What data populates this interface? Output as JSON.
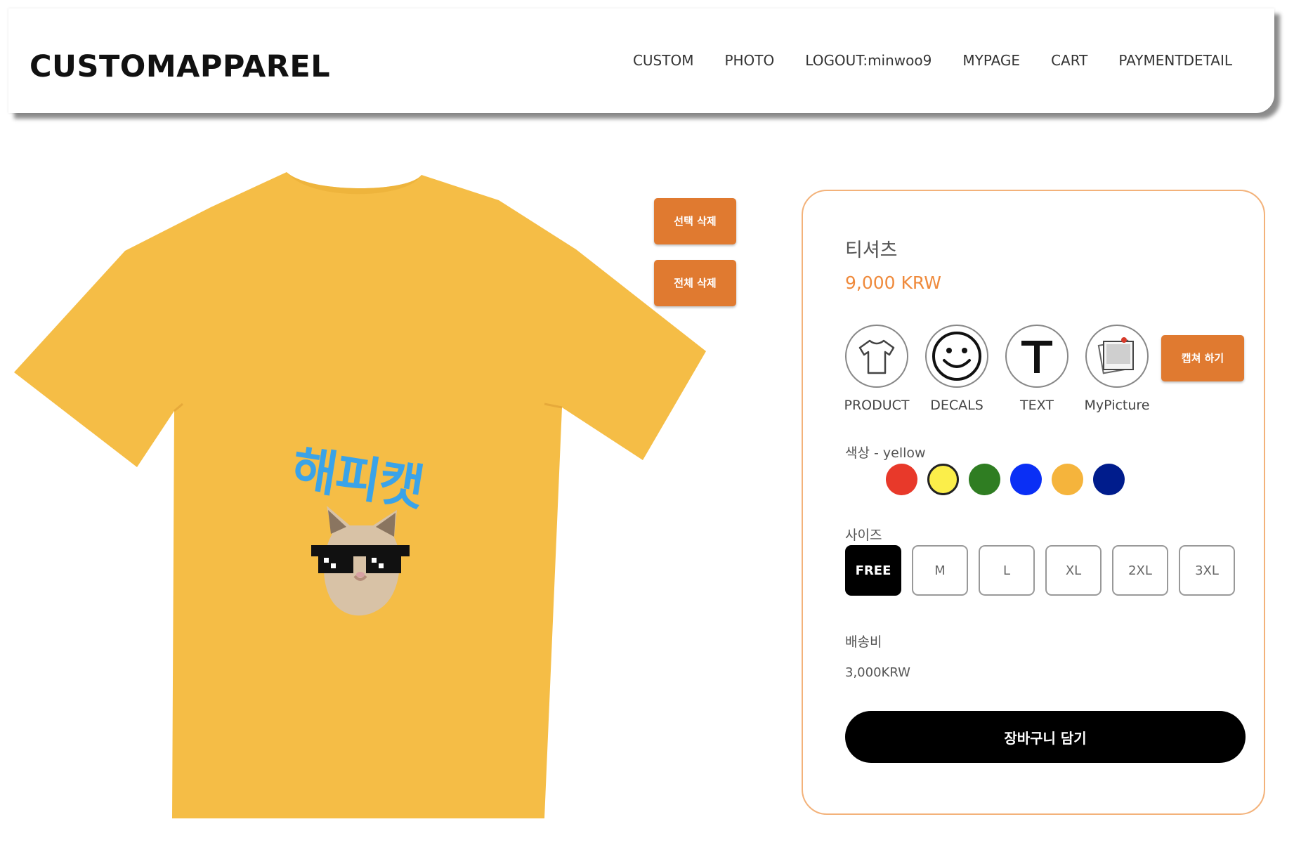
{
  "header": {
    "logo": "CUSTOMAPPAREL",
    "nav": {
      "custom": "CUSTOM",
      "photo": "PHOTO",
      "logout": "LOGOUT:minwoo9",
      "mypage": "MYPAGE",
      "cart": "CART",
      "payment": "PAYMENTDETAIL"
    }
  },
  "canvas": {
    "shirt_color": "#f5bd46",
    "decal_text": "해피캣",
    "decal_text_color": "#3aa3e8",
    "decal_image": "cat-with-pixel-sunglasses",
    "delete_selected_label": "선택 삭제",
    "delete_all_label": "전체 삭제",
    "button_color": "#e07a30"
  },
  "product": {
    "name": "티셔츠",
    "price": "9,000 KRW",
    "tools": [
      {
        "label": "PRODUCT",
        "icon": "tshirt-icon"
      },
      {
        "label": "DECALS",
        "icon": "smiley-icon"
      },
      {
        "label": "TEXT",
        "icon": "text-icon"
      },
      {
        "label": "MyPicture",
        "icon": "photo-stack-icon"
      }
    ],
    "capture_label": "캡쳐 하기",
    "color_label": "색상  - yellow",
    "colors": [
      {
        "name": "red",
        "hex": "#e8392a"
      },
      {
        "name": "yellow",
        "hex": "#fbee4a",
        "selected": true
      },
      {
        "name": "green",
        "hex": "#2f7d22"
      },
      {
        "name": "blue",
        "hex": "#0a2ff5"
      },
      {
        "name": "orange",
        "hex": "#f5b43c"
      },
      {
        "name": "navy",
        "hex": "#001c8c"
      }
    ],
    "size_label": "사이즈",
    "sizes": [
      "FREE",
      "M",
      "L",
      "XL",
      "2XL",
      "3XL"
    ],
    "selected_size": "FREE",
    "shipping_label": "배송비",
    "shipping_value": "3,000KRW",
    "add_to_cart": "장바구니 담기"
  }
}
